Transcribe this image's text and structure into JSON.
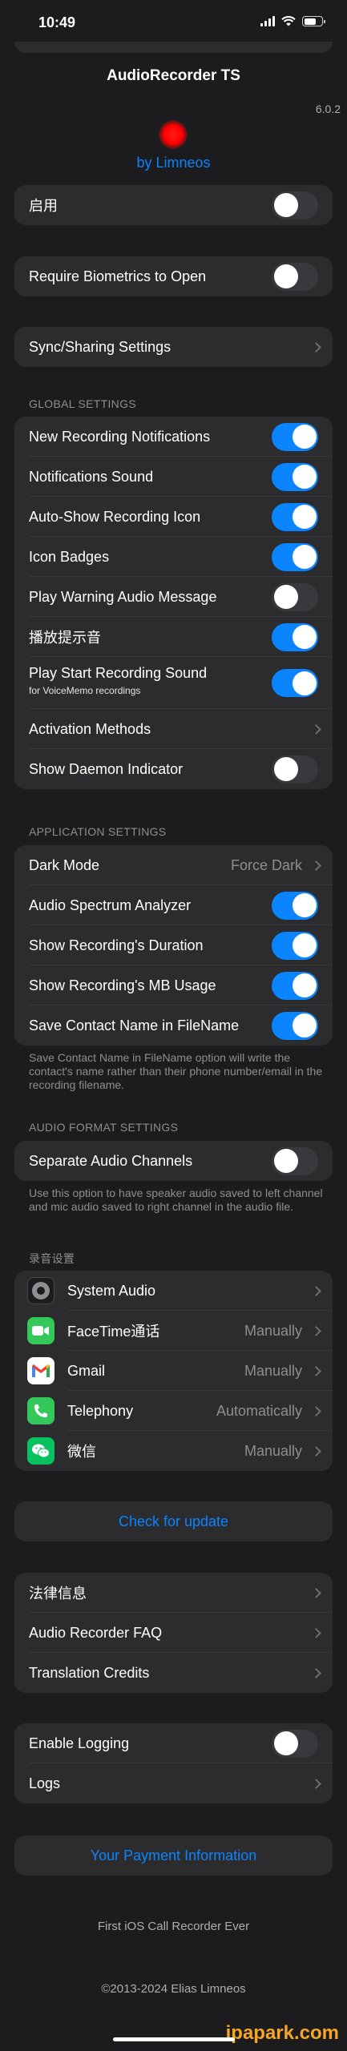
{
  "status": {
    "time": "10:49"
  },
  "header": {
    "title": "AudioRecorder TS",
    "version": "6.0.2",
    "byline": "by Limneos"
  },
  "toggles": {
    "enable": {
      "label": "启用",
      "on": false
    },
    "biometrics": {
      "label": "Require Biometrics to Open",
      "on": false
    }
  },
  "sync": {
    "label": "Sync/Sharing Settings"
  },
  "global": {
    "header": "GLOBAL SETTINGS",
    "items": [
      {
        "label": "New Recording Notifications",
        "type": "toggle",
        "on": true
      },
      {
        "label": "Notifications Sound",
        "type": "toggle",
        "on": true
      },
      {
        "label": "Auto-Show Recording Icon",
        "type": "toggle",
        "on": true
      },
      {
        "label": "Icon Badges",
        "type": "toggle",
        "on": true
      },
      {
        "label": "Play Warning Audio Message",
        "type": "toggle",
        "on": false
      },
      {
        "label": "播放提示音",
        "type": "toggle",
        "on": true
      },
      {
        "label": "Play Start Recording Sound",
        "sub": "for VoiceMemo recordings",
        "type": "toggle",
        "on": true
      },
      {
        "label": "Activation Methods",
        "type": "link"
      },
      {
        "label": "Show Daemon Indicator",
        "type": "toggle",
        "on": false
      }
    ]
  },
  "app": {
    "header": "APPLICATION SETTINGS",
    "items": [
      {
        "label": "Dark Mode",
        "type": "link",
        "value": "Force Dark"
      },
      {
        "label": "Audio Spectrum Analyzer",
        "type": "toggle",
        "on": true
      },
      {
        "label": "Show Recording's Duration",
        "type": "toggle",
        "on": true
      },
      {
        "label": "Show Recording's MB Usage",
        "type": "toggle",
        "on": true
      },
      {
        "label": "Save Contact Name in FileName",
        "type": "toggle",
        "on": true
      }
    ],
    "footnote": "Save Contact Name in FileName option will write the contact's name rather than their phone number/email in the recording filename."
  },
  "format": {
    "header": "AUDIO FORMAT SETTINGS",
    "items": [
      {
        "label": "Separate Audio Channels",
        "type": "toggle",
        "on": false
      }
    ],
    "footnote": "Use this option to have speaker audio saved to left channel and mic audio saved to right channel in the audio file."
  },
  "rec": {
    "header": "录音设置",
    "items": [
      {
        "label": "System Audio",
        "value": "",
        "icon": "system-audio-icon"
      },
      {
        "label": "FaceTime通话",
        "value": "Manually",
        "icon": "facetime-icon"
      },
      {
        "label": "Gmail",
        "value": "Manually",
        "icon": "gmail-icon"
      },
      {
        "label": "Telephony",
        "value": "Automatically",
        "icon": "phone-icon"
      },
      {
        "label": "微信",
        "value": "Manually",
        "icon": "wechat-icon"
      }
    ]
  },
  "update": {
    "label": "Check for update"
  },
  "info": {
    "items": [
      {
        "label": "法律信息"
      },
      {
        "label": "Audio Recorder FAQ"
      },
      {
        "label": "Translation Credits"
      }
    ]
  },
  "logging": {
    "enable": {
      "label": "Enable Logging",
      "on": false
    },
    "logs": {
      "label": "Logs"
    }
  },
  "payment": {
    "label": "Your Payment Information"
  },
  "footer": {
    "tagline": "First iOS Call Recorder Ever",
    "copyright": "©2013-2024 Elias Limneos"
  },
  "watermark": "ipapark.com",
  "colors": {
    "accent": "#0a84ff",
    "background": "#1c1c1e",
    "cell": "#2c2c2e",
    "record": "#ff0000"
  }
}
